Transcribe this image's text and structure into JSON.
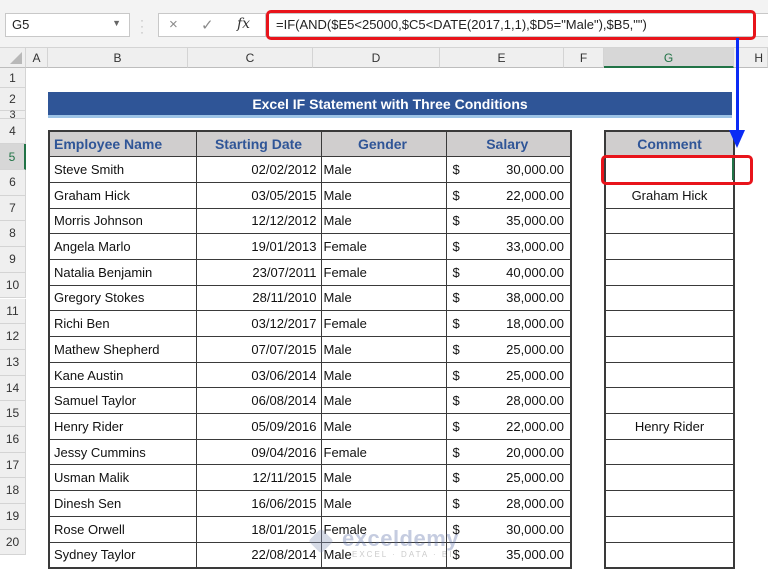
{
  "formula_bar": {
    "name_box": "G5",
    "formula": "=IF(AND($E5<25000,$C5<DATE(2017,1,1),$D5=\"Male\"),$B5,\"\")",
    "cancel_icon": "×",
    "enter_icon": "✓",
    "fx_icon": "fx"
  },
  "columns": [
    "A",
    "B",
    "C",
    "D",
    "E",
    "F",
    "G",
    "H"
  ],
  "selected_column": "G",
  "rows": [
    "1",
    "2",
    "3",
    "4",
    "5",
    "6",
    "7",
    "8",
    "9",
    "10",
    "11",
    "12",
    "13",
    "14",
    "15",
    "16",
    "17",
    "18",
    "19",
    "20"
  ],
  "selected_row": "5",
  "banner": {
    "title": "Excel IF Statement with Three Conditions"
  },
  "table": {
    "headers": [
      "Employee Name",
      "Starting Date",
      "Gender",
      "Salary"
    ],
    "currency_symbol": "$",
    "records": [
      {
        "name": "Steve Smith",
        "date": "02/02/2012",
        "gender": "Male",
        "salary": "30,000.00"
      },
      {
        "name": "Graham Hick",
        "date": "03/05/2015",
        "gender": "Male",
        "salary": "22,000.00"
      },
      {
        "name": "Morris Johnson",
        "date": "12/12/2012",
        "gender": "Male",
        "salary": "35,000.00"
      },
      {
        "name": "Angela Marlo",
        "date": "19/01/2013",
        "gender": "Female",
        "salary": "33,000.00"
      },
      {
        "name": "Natalia Benjamin",
        "date": "23/07/2011",
        "gender": "Female",
        "salary": "40,000.00"
      },
      {
        "name": "Gregory Stokes",
        "date": "28/11/2010",
        "gender": "Male",
        "salary": "38,000.00"
      },
      {
        "name": "Richi Ben",
        "date": "03/12/2017",
        "gender": "Female",
        "salary": "18,000.00"
      },
      {
        "name": "Mathew Shepherd",
        "date": "07/07/2015",
        "gender": "Male",
        "salary": "25,000.00"
      },
      {
        "name": "Kane Austin",
        "date": "03/06/2014",
        "gender": "Male",
        "salary": "25,000.00"
      },
      {
        "name": "Samuel Taylor",
        "date": "06/08/2014",
        "gender": "Male",
        "salary": "28,000.00"
      },
      {
        "name": "Henry Rider",
        "date": "05/09/2016",
        "gender": "Male",
        "salary": "22,000.00"
      },
      {
        "name": "Jessy Cummins",
        "date": "09/04/2016",
        "gender": "Female",
        "salary": "20,000.00"
      },
      {
        "name": "Usman Malik",
        "date": "12/11/2015",
        "gender": "Male",
        "salary": "25,000.00"
      },
      {
        "name": "Dinesh Sen",
        "date": "16/06/2015",
        "gender": "Male",
        "salary": "28,000.00"
      },
      {
        "name": "Rose Orwell",
        "date": "18/01/2015",
        "gender": "Female",
        "salary": "30,000.00"
      },
      {
        "name": "Sydney Taylor",
        "date": "22/08/2014",
        "gender": "Male",
        "salary": "35,000.00"
      }
    ]
  },
  "comment_table": {
    "header": "Comment",
    "values": [
      "",
      "Graham Hick",
      "",
      "",
      "",
      "",
      "",
      "",
      "",
      "",
      "Henry Rider",
      "",
      "",
      "",
      "",
      ""
    ]
  },
  "watermark": {
    "brand": "exceldemy",
    "tagline": "EXCEL · DATA · BI"
  },
  "colors": {
    "banner": "#2f5597",
    "header_fill": "#d0cece",
    "header_text": "#2f5597",
    "highlight": "#e8141b",
    "arrow": "#0a2bf5",
    "excel_green": "#217346"
  }
}
